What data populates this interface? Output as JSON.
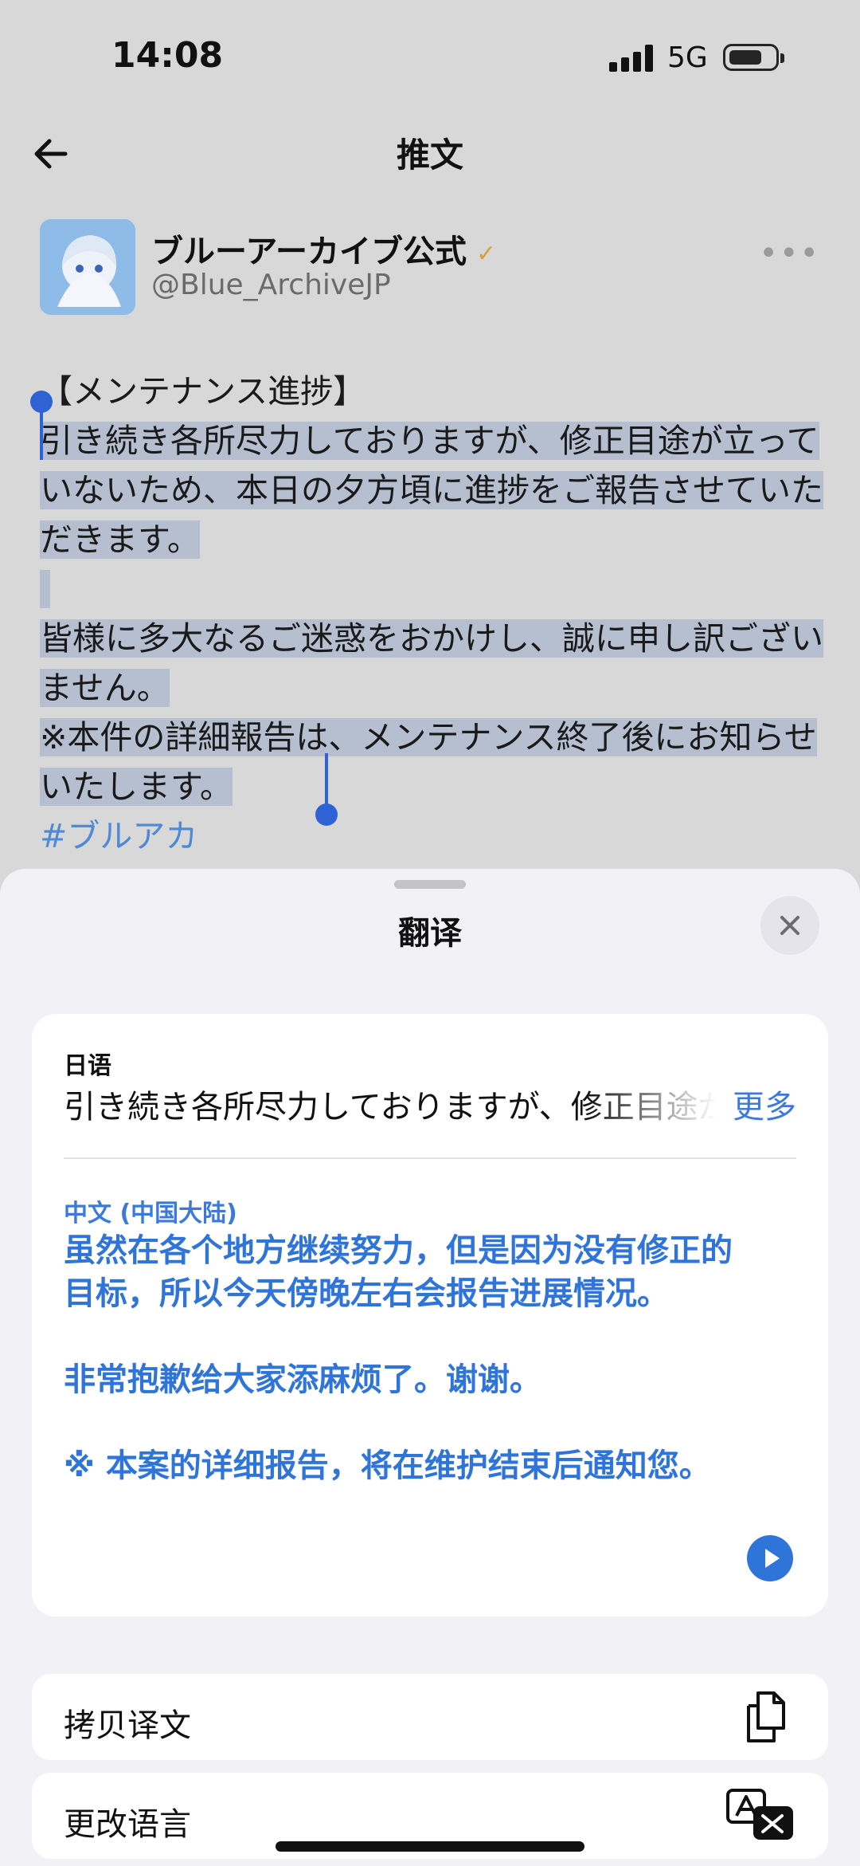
{
  "status_bar": {
    "time": "14:08",
    "network": "5G"
  },
  "header": {
    "title": "推文"
  },
  "author": {
    "name": "ブルーアーカイブ公式",
    "handle": "@Blue_ArchiveJP"
  },
  "tweet": {
    "heading": "【メンテナンス進捗】",
    "para1": "引き続き各所尽力しておりますが、修正目途が立っていないため、本日の夕方頃に進捗をご報告させていただきます。",
    "para2": "皆様に多大なるご迷惑をおかけし、誠に申し訳ございません。",
    "para3": "※本件の詳細報告は、メンテナンス終了後にお知らせいたします。",
    "hashtag": "#ブルアカ"
  },
  "translate_sheet": {
    "title": "翻译",
    "source_language": "日语",
    "source_text": "引き続き各所尽力しておりますが、修正目途が立っていないため",
    "more_label": "更多",
    "target_language": "中文 (中国大陆)",
    "translation_p1": "虽然在各个地方继续努力，但是因为没有修正的目标，所以今天傍晚左右会报告进展情况。",
    "translation_p2": "非常抱歉给大家添麻烦了。谢谢。",
    "translation_p3": "※ 本案的详细报告，将在维护结束后通知您。",
    "copy_label": "拷贝译文",
    "change_language_label": "更改语言"
  }
}
